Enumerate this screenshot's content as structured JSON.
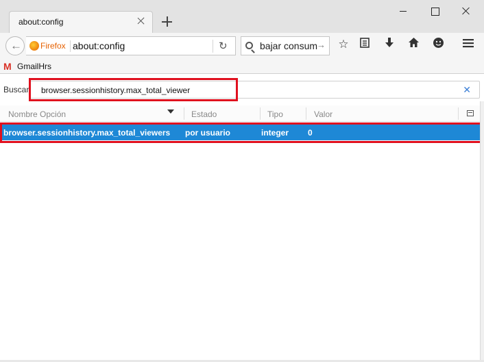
{
  "window": {
    "tab_title": "about:config"
  },
  "navbar": {
    "identity_label": "Firefox",
    "url": "about:config",
    "search_value": "bajar consum"
  },
  "bookmarks": {
    "items": [
      {
        "label": "GmailHrs",
        "icon": "gmail-icon"
      }
    ]
  },
  "config": {
    "filter_label": "Buscar:",
    "filter_value": "browser.sessionhistory.max_total_viewer",
    "columns": [
      "Nombre Opción",
      "Estado",
      "Tipo",
      "Valor"
    ],
    "rows": [
      {
        "name": "browser.sessionhistory.max_total_viewers",
        "status": "por usuario",
        "type": "integer",
        "value": "0"
      }
    ]
  },
  "colors": {
    "selected_row": "#1e88d6",
    "highlight_box": "#e0101e",
    "firefox_orange": "#e66000"
  }
}
